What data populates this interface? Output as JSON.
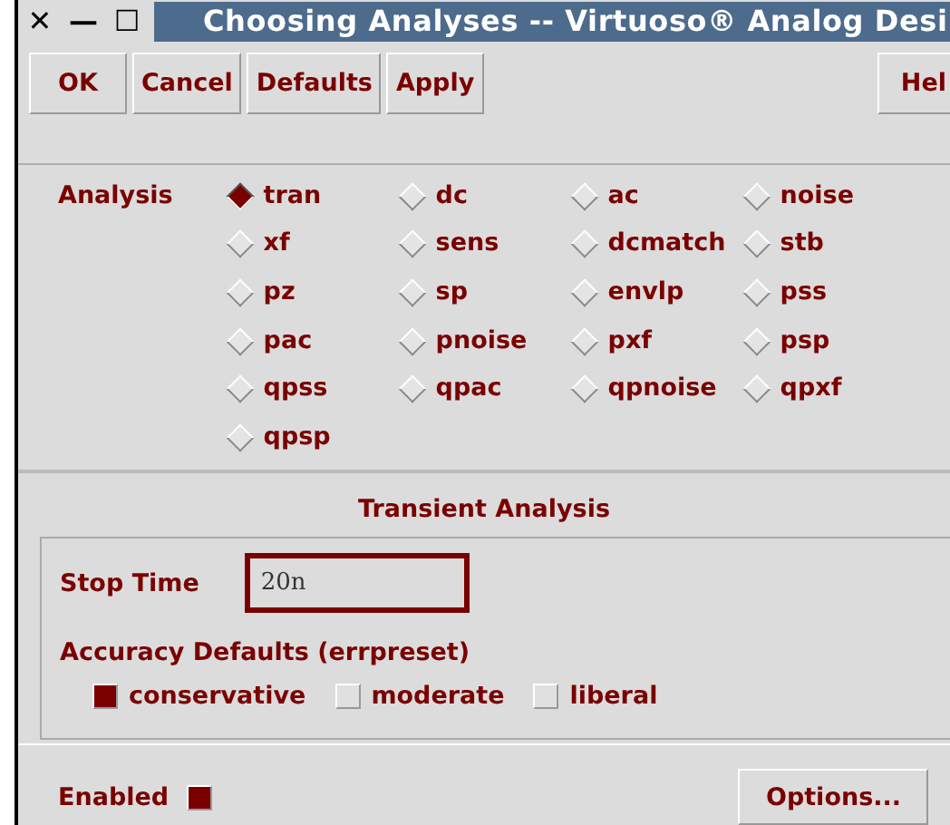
{
  "window": {
    "title": "Choosing Analyses -- Virtuoso® Analog Desi",
    "controls": [
      "✕",
      "—",
      "☐"
    ]
  },
  "buttons": [
    "OK",
    "Cancel",
    "Defaults",
    "Apply"
  ],
  "help_button": "Hel",
  "analysis": {
    "label": "Analysis",
    "options": [
      {
        "label": "tran",
        "selected": true
      },
      {
        "label": "dc",
        "selected": false
      },
      {
        "label": "ac",
        "selected": false
      },
      {
        "label": "noise",
        "selected": false
      },
      {
        "label": "xf",
        "selected": false
      },
      {
        "label": "sens",
        "selected": false
      },
      {
        "label": "dcmatch",
        "selected": false
      },
      {
        "label": "stb",
        "selected": false
      },
      {
        "label": "pz",
        "selected": false
      },
      {
        "label": "sp",
        "selected": false
      },
      {
        "label": "envlp",
        "selected": false
      },
      {
        "label": "pss",
        "selected": false
      },
      {
        "label": "pac",
        "selected": false
      },
      {
        "label": "pnoise",
        "selected": false
      },
      {
        "label": "pxf",
        "selected": false
      },
      {
        "label": "psp",
        "selected": false
      },
      {
        "label": "qpss",
        "selected": false
      },
      {
        "label": "qpac",
        "selected": false
      },
      {
        "label": "qpnoise",
        "selected": false
      },
      {
        "label": "qpxf",
        "selected": false
      },
      {
        "label": "qpsp",
        "selected": false
      }
    ]
  },
  "section_title": "Transient Analysis",
  "stop_time": {
    "label": "Stop Time",
    "value": "20n"
  },
  "accuracy": {
    "label": "Accuracy Defaults (errpreset)",
    "options": [
      {
        "label": "conservative",
        "selected": true
      },
      {
        "label": "moderate",
        "selected": false
      },
      {
        "label": "liberal",
        "selected": false
      }
    ]
  },
  "enabled": {
    "label": "Enabled",
    "checked": true
  },
  "options_button": "Options..."
}
